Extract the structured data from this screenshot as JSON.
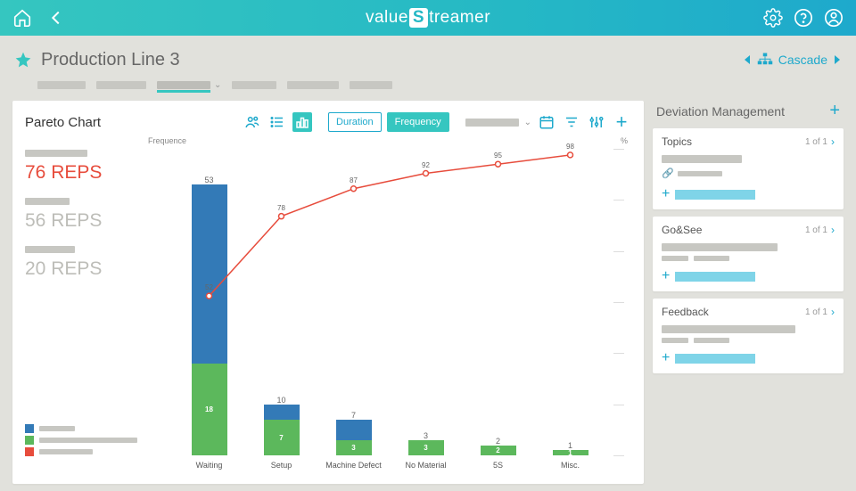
{
  "header": {
    "brand_pre": "value",
    "brand_mid": "S",
    "brand_post": "treamer"
  },
  "page": {
    "title": "Production Line 3",
    "cascade_label": "Cascade"
  },
  "card": {
    "title": "Pareto Chart",
    "toggle_duration": "Duration",
    "toggle_frequency": "Frequency",
    "ylabel": "Frequence",
    "ylabel_right": "%"
  },
  "stats": {
    "s1": "76 REPS",
    "s2": "56 REPS",
    "s3": "20 REPS"
  },
  "side": {
    "title": "Deviation Management",
    "topics": {
      "title": "Topics",
      "count": "1 of 1"
    },
    "gosee": {
      "title": "Go&See",
      "count": "1 of 1"
    },
    "feedback": {
      "title": "Feedback",
      "count": "1 of 1"
    }
  },
  "chart_data": {
    "type": "bar",
    "title": "Pareto Chart",
    "xlabel": "",
    "ylabel": "Frequence",
    "y2label": "%",
    "categories": [
      "Waiting",
      "Setup",
      "Machine Defect",
      "No Material",
      "5S",
      "Misc."
    ],
    "series": [
      {
        "name": "green",
        "color": "#5cb85c",
        "values": [
          18,
          7,
          3,
          3,
          2,
          1
        ]
      },
      {
        "name": "blue",
        "color": "#337ab7",
        "values": [
          35,
          3,
          4,
          0,
          0,
          0
        ]
      }
    ],
    "totals": [
      53,
      10,
      7,
      3,
      2,
      1
    ],
    "cumulative_line": {
      "name": "cumulative %",
      "color": "#e74c3c",
      "values": [
        52,
        78,
        87,
        92,
        95,
        98
      ]
    },
    "ylim": [
      0,
      60
    ],
    "y2lim": [
      0,
      100
    ]
  }
}
